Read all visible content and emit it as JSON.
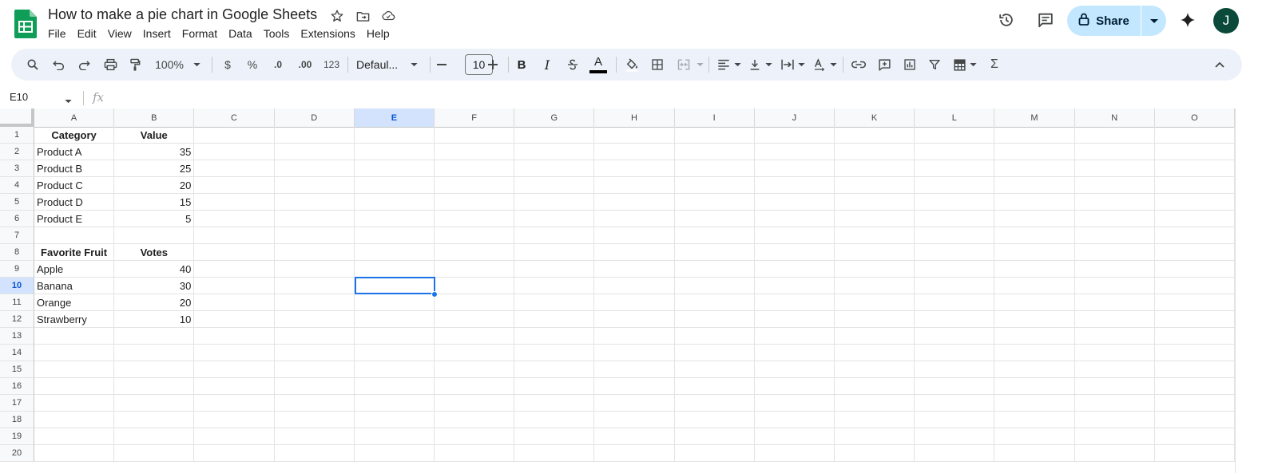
{
  "document": {
    "title": "How to make a pie chart in Google Sheets"
  },
  "menu": [
    "File",
    "Edit",
    "View",
    "Insert",
    "Format",
    "Data",
    "Tools",
    "Extensions",
    "Help"
  ],
  "share": {
    "label": "Share"
  },
  "user": {
    "avatar_initial": "J"
  },
  "toolbar": {
    "zoom": "100%",
    "currency": "$",
    "percent": "%",
    "decrease_decimal": ".0",
    "increase_decimal": ".00",
    "number_format": "123",
    "font": "Defaul...",
    "font_size": "10",
    "bold": "B",
    "italic": "I",
    "text_color_letter": "A",
    "functions": "Σ"
  },
  "formula_bar": {
    "name_box": "E10",
    "fx_label": "fx"
  },
  "grid": {
    "columns": [
      "A",
      "B",
      "C",
      "D",
      "E",
      "F",
      "G",
      "H",
      "I",
      "J",
      "K",
      "L",
      "M",
      "N",
      "O"
    ],
    "active_column": "E",
    "active_row": 10,
    "rows": [
      {
        "n": "1",
        "a": "Category",
        "b": "Value",
        "header": true
      },
      {
        "n": "2",
        "a": "Product A",
        "b": "35"
      },
      {
        "n": "3",
        "a": "Product B",
        "b": "25"
      },
      {
        "n": "4",
        "a": "Product C",
        "b": "20"
      },
      {
        "n": "5",
        "a": "Product D",
        "b": "15"
      },
      {
        "n": "6",
        "a": "Product E",
        "b": "5"
      },
      {
        "n": "7",
        "a": "",
        "b": ""
      },
      {
        "n": "8",
        "a": "Favorite Fruit",
        "b": "Votes",
        "header": true
      },
      {
        "n": "9",
        "a": "Apple",
        "b": "40"
      },
      {
        "n": "10",
        "a": "Banana",
        "b": "30"
      },
      {
        "n": "11",
        "a": "Orange",
        "b": "20"
      },
      {
        "n": "12",
        "a": "Strawberry",
        "b": "10"
      },
      {
        "n": "13",
        "a": "",
        "b": ""
      },
      {
        "n": "14",
        "a": "",
        "b": ""
      },
      {
        "n": "15",
        "a": "",
        "b": ""
      },
      {
        "n": "16",
        "a": "",
        "b": ""
      },
      {
        "n": "17",
        "a": "",
        "b": ""
      },
      {
        "n": "18",
        "a": "",
        "b": ""
      },
      {
        "n": "19",
        "a": "",
        "b": ""
      },
      {
        "n": "20",
        "a": "",
        "b": ""
      }
    ]
  },
  "colors": {
    "sheets_green": "#0f9d58",
    "selection_blue": "#1a73e8",
    "share_bg": "#c2e7ff",
    "toolbar_bg": "#edf2fa",
    "avatar_bg": "#0b4a3a"
  }
}
